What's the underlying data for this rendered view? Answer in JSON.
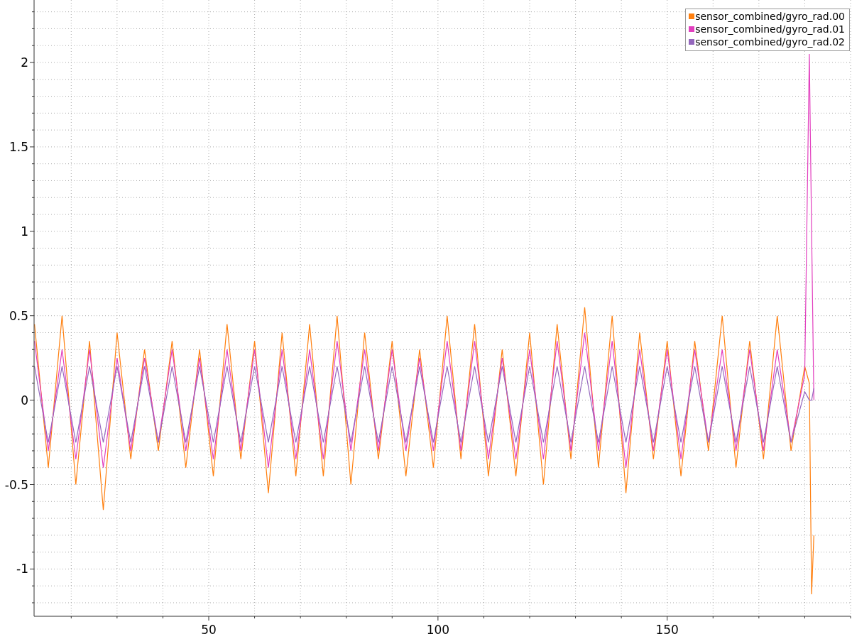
{
  "chart_data": {
    "type": "line",
    "grid": true,
    "legend": true,
    "xlim": [
      11.9,
      190
    ],
    "ylim": [
      -1.28,
      2.37
    ],
    "xticks": [
      50,
      100,
      150
    ],
    "yticks": [
      -1,
      -0.5,
      0,
      0.5,
      1,
      1.5,
      2
    ],
    "x": [
      12,
      15,
      18,
      21,
      24,
      27,
      30,
      33,
      36,
      39,
      42,
      45,
      48,
      51,
      54,
      57,
      60,
      63,
      66,
      69,
      72,
      75,
      78,
      81,
      84,
      87,
      90,
      93,
      96,
      99,
      102,
      105,
      108,
      111,
      114,
      117,
      120,
      123,
      126,
      129,
      132,
      135,
      138,
      141,
      144,
      147,
      150,
      153,
      156,
      159,
      162,
      165,
      168,
      171,
      174,
      177,
      180,
      181,
      181.5,
      182
    ],
    "series": [
      {
        "name": "sensor_combined/gyro_rad.00",
        "color": "#ff7f0e",
        "values": [
          0.45,
          -0.4,
          0.5,
          -0.5,
          0.35,
          -0.65,
          0.4,
          -0.35,
          0.3,
          -0.3,
          0.35,
          -0.4,
          0.3,
          -0.45,
          0.45,
          -0.35,
          0.35,
          -0.55,
          0.4,
          -0.45,
          0.45,
          -0.45,
          0.5,
          -0.5,
          0.4,
          -0.35,
          0.35,
          -0.45,
          0.3,
          -0.4,
          0.5,
          -0.35,
          0.45,
          -0.45,
          0.3,
          -0.45,
          0.4,
          -0.5,
          0.45,
          -0.35,
          0.55,
          -0.4,
          0.5,
          -0.55,
          0.4,
          -0.35,
          0.35,
          -0.45,
          0.35,
          -0.3,
          0.5,
          -0.4,
          0.35,
          -0.35,
          0.5,
          -0.3,
          0.2,
          0.1,
          -1.15,
          -0.8
        ]
      },
      {
        "name": "sensor_combined/gyro_rad.01",
        "color": "#e23fbf",
        "values": [
          0.35,
          -0.3,
          0.3,
          -0.35,
          0.3,
          -0.4,
          0.25,
          -0.3,
          0.25,
          -0.25,
          0.3,
          -0.3,
          0.25,
          -0.35,
          0.3,
          -0.3,
          0.3,
          -0.4,
          0.3,
          -0.35,
          0.3,
          -0.35,
          0.35,
          -0.3,
          0.3,
          -0.3,
          0.3,
          -0.3,
          0.25,
          -0.3,
          0.35,
          -0.3,
          0.35,
          -0.35,
          0.25,
          -0.35,
          0.3,
          -0.35,
          0.35,
          -0.3,
          0.4,
          -0.3,
          0.35,
          -0.4,
          0.3,
          -0.3,
          0.3,
          -0.35,
          0.3,
          -0.25,
          0.3,
          -0.3,
          0.3,
          -0.3,
          0.3,
          -0.25,
          0.15,
          2.05,
          1.0,
          0
        ]
      },
      {
        "name": "sensor_combined/gyro_rad.02",
        "color": "#9467bd",
        "values": [
          0.2,
          -0.25,
          0.2,
          -0.25,
          0.2,
          -0.25,
          0.2,
          -0.25,
          0.2,
          -0.25,
          0.2,
          -0.25,
          0.2,
          -0.25,
          0.2,
          -0.25,
          0.2,
          -0.25,
          0.2,
          -0.25,
          0.2,
          -0.25,
          0.2,
          -0.25,
          0.2,
          -0.25,
          0.2,
          -0.25,
          0.2,
          -0.25,
          0.2,
          -0.25,
          0.2,
          -0.25,
          0.2,
          -0.25,
          0.2,
          -0.25,
          0.2,
          -0.25,
          0.2,
          -0.25,
          0.2,
          -0.25,
          0.2,
          -0.25,
          0.2,
          -0.25,
          0.2,
          -0.25,
          0.2,
          -0.25,
          0.2,
          -0.25,
          0.2,
          -0.25,
          0.05,
          0,
          0,
          0.07
        ]
      }
    ]
  }
}
